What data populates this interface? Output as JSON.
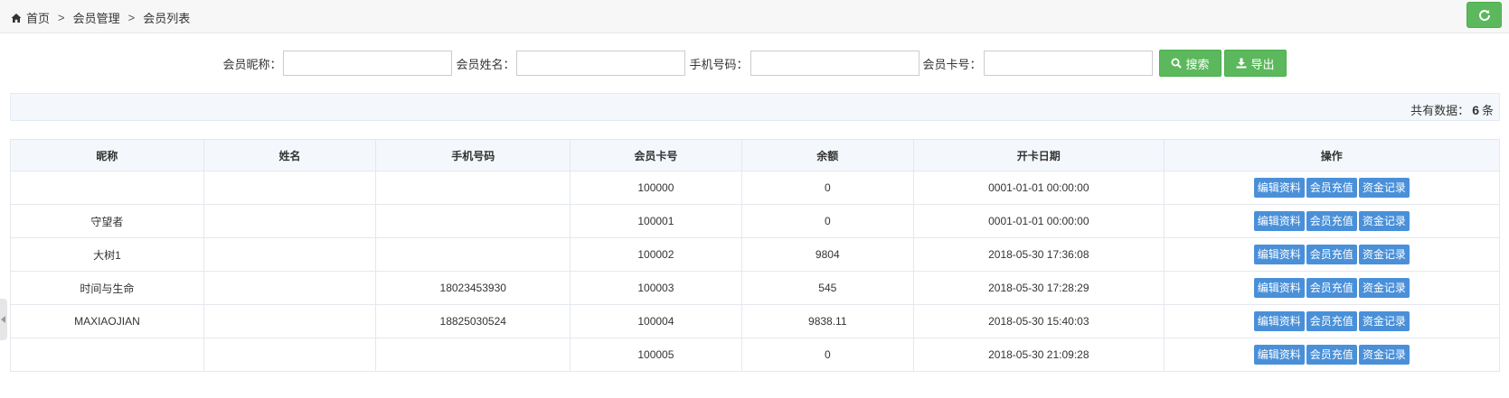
{
  "breadcrumb": {
    "home": "首页",
    "sep": ">",
    "level2": "会员管理",
    "level3": "会员列表"
  },
  "search": {
    "nickname_label": "会员昵称：",
    "name_label": "会员姓名：",
    "phone_label": "手机号码：",
    "card_label": "会员卡号：",
    "nickname_value": "",
    "name_value": "",
    "phone_value": "",
    "card_value": "",
    "search_button": "搜索",
    "export_button": "导出"
  },
  "summary": {
    "prefix": "共有数据：",
    "count": "6",
    "suffix": "条"
  },
  "table": {
    "headers": [
      "昵称",
      "姓名",
      "手机号码",
      "会员卡号",
      "余额",
      "开卡日期",
      "操作"
    ],
    "actions": [
      "编辑资料",
      "会员充值",
      "资金记录"
    ],
    "rows": [
      {
        "nickname": "",
        "name": "",
        "phone": "",
        "card": "100000",
        "balance": "0",
        "date": "0001-01-01 00:00:00"
      },
      {
        "nickname": "守望者",
        "name": "",
        "phone": "",
        "card": "100001",
        "balance": "0",
        "date": "0001-01-01 00:00:00"
      },
      {
        "nickname": "大树1",
        "name": "",
        "phone": "",
        "card": "100002",
        "balance": "9804",
        "date": "2018-05-30 17:36:08"
      },
      {
        "nickname": "时间与生命",
        "name": "",
        "phone": "18023453930",
        "card": "100003",
        "balance": "545",
        "date": "2018-05-30 17:28:29"
      },
      {
        "nickname": "MAXIAOJIAN",
        "name": "",
        "phone": "18825030524",
        "card": "100004",
        "balance": "9838.11",
        "date": "2018-05-30 15:40:03"
      },
      {
        "nickname": "",
        "name": "",
        "phone": "",
        "card": "100005",
        "balance": "0",
        "date": "2018-05-30 21:09:28"
      }
    ]
  },
  "icons": {
    "home": "home-icon",
    "refresh": "refresh-icon",
    "search": "search-icon",
    "export": "download-icon",
    "collapse": "chevron-left-icon"
  },
  "colors": {
    "green": "#5cb85c",
    "blue": "#4a90d9",
    "header_bg": "#f4f8fc"
  }
}
